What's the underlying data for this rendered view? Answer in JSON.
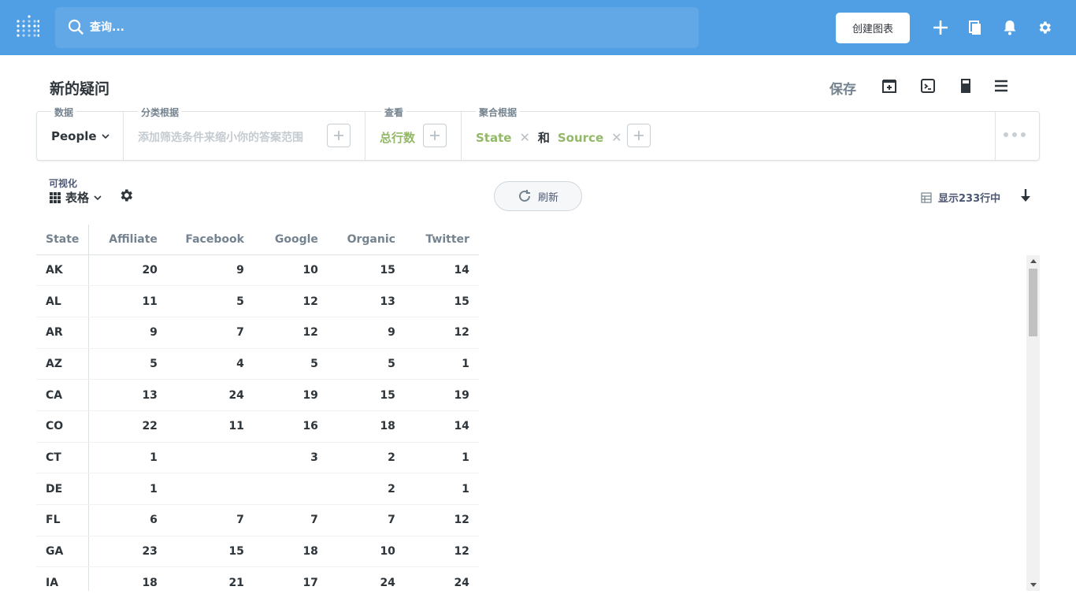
{
  "topbar": {
    "search_placeholder": "查询...",
    "create_chart_label": "创建图表"
  },
  "header": {
    "title": "新的疑问",
    "save_label": "保存"
  },
  "query_builder": {
    "data": {
      "label": "数据",
      "value": "People"
    },
    "filter": {
      "label": "分类根据",
      "placeholder": "添加筛选条件来缩小你的答案范围"
    },
    "view": {
      "label": "查看",
      "value": "总行数"
    },
    "group": {
      "label": "聚合根据",
      "field1": "State",
      "conj": "和",
      "field2": "Source"
    }
  },
  "viz": {
    "label": "可视化",
    "type": "表格",
    "refresh_label": "刷新",
    "row_count": "显示233行中"
  },
  "table": {
    "columns": [
      "State",
      "Affiliate",
      "Facebook",
      "Google",
      "Organic",
      "Twitter"
    ],
    "rows": [
      [
        "AK",
        "20",
        "9",
        "10",
        "15",
        "14"
      ],
      [
        "AL",
        "11",
        "5",
        "12",
        "13",
        "15"
      ],
      [
        "AR",
        "9",
        "7",
        "12",
        "9",
        "12"
      ],
      [
        "AZ",
        "5",
        "4",
        "5",
        "5",
        "1"
      ],
      [
        "CA",
        "13",
        "24",
        "19",
        "15",
        "19"
      ],
      [
        "CO",
        "22",
        "11",
        "16",
        "18",
        "14"
      ],
      [
        "CT",
        "1",
        "",
        "3",
        "2",
        "1"
      ],
      [
        "DE",
        "1",
        "",
        "",
        "2",
        "1"
      ],
      [
        "FL",
        "6",
        "7",
        "7",
        "7",
        "12"
      ],
      [
        "GA",
        "23",
        "15",
        "18",
        "10",
        "12"
      ],
      [
        "IA",
        "18",
        "21",
        "17",
        "24",
        "24"
      ]
    ]
  },
  "colors": {
    "brand": "#509ee3",
    "accent_green": "#93b868"
  }
}
